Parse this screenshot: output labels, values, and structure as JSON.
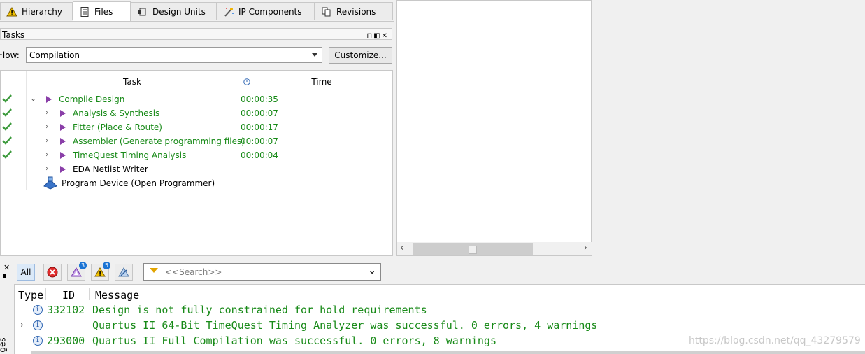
{
  "tabs": [
    {
      "label": "Hierarchy",
      "icon": "hierarchy-warning-icon"
    },
    {
      "label": "Files",
      "icon": "files-icon",
      "active": true
    },
    {
      "label": "Design Units",
      "icon": "design-units-icon"
    },
    {
      "label": "IP Components",
      "icon": "ip-components-wand-icon"
    },
    {
      "label": "Revisions",
      "icon": "revisions-icon"
    }
  ],
  "tasks": {
    "title": "Tasks",
    "flow_label": "Flow:",
    "flow_value": "Compilation",
    "customize_label": "Customize...",
    "columns": {
      "task": "Task",
      "time": "Time"
    },
    "rows": [
      {
        "label": "Compile Design",
        "time": "00:00:35",
        "done": true
      },
      {
        "label": "Analysis & Synthesis",
        "time": "00:00:07",
        "done": true
      },
      {
        "label": "Fitter (Place & Route)",
        "time": "00:00:17",
        "done": true
      },
      {
        "label": "Assembler (Generate programming files)",
        "time": "00:00:07",
        "done": true
      },
      {
        "label": "TimeQuest Timing Analysis",
        "time": "00:00:04",
        "done": true
      },
      {
        "label": "EDA Netlist Writer",
        "time": "",
        "done": false
      },
      {
        "label": "Program Device (Open Programmer)",
        "time": "",
        "done": false
      }
    ]
  },
  "messages": {
    "filter_all": "All",
    "critical_warning_count": "3",
    "warning_count": "5",
    "search_placeholder": "<<Search>>",
    "side_label": "ges",
    "columns": {
      "type": "Type",
      "id": "ID",
      "message": "Message"
    },
    "rows": [
      {
        "id": "332102",
        "text": "Design is not fully constrained for hold requirements"
      },
      {
        "id": "",
        "text": "Quartus II 64-Bit TimeQuest Timing Analyzer was successful. 0 errors, 4 warnings"
      },
      {
        "id": "293000",
        "text": "Quartus II Full Compilation was successful. 0 errors, 8 warnings"
      }
    ]
  },
  "watermark": "https://blog.csdn.net/qq_43279579",
  "colors": {
    "success_text": "#188a18",
    "play_icon": "#8a3fa8",
    "check": "#3e9b3e"
  }
}
